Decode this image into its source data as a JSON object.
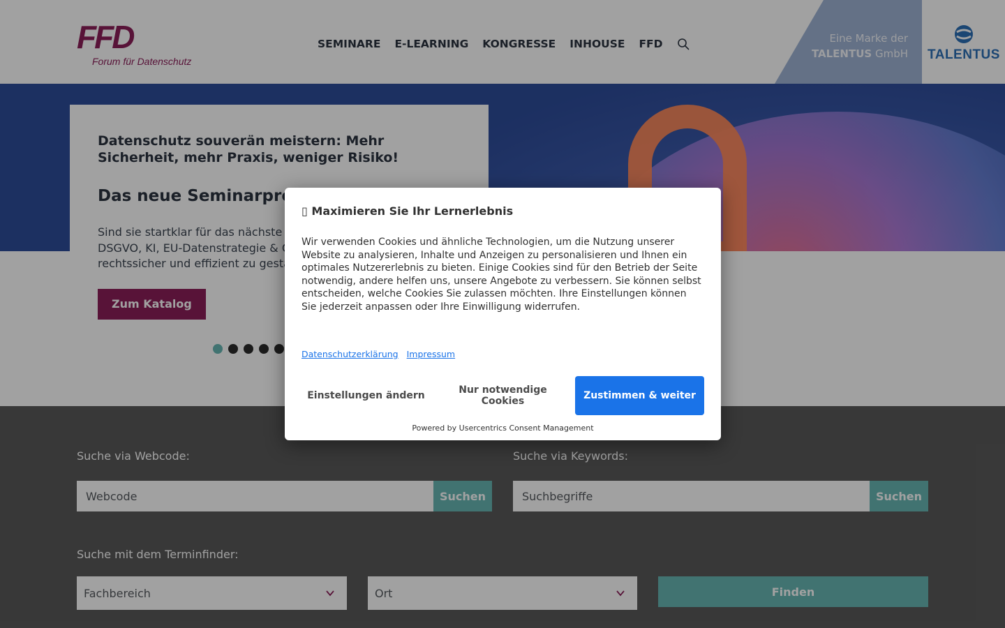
{
  "header": {
    "logo": {
      "mark": "FFD",
      "subtitle": "Forum für Datenschutz"
    },
    "nav": [
      {
        "label": "SEMINARE"
      },
      {
        "label": "E-LEARNING"
      },
      {
        "label": "KONGRESSE"
      },
      {
        "label": "INHOUSE"
      },
      {
        "label": "FFD"
      }
    ],
    "search_icon": "search-icon",
    "brand": {
      "line1": "Eine Marke der",
      "line2_bold": "TALENTUS",
      "line2_rest": " GmbH"
    },
    "talentus_logo_text": "TALENTUS"
  },
  "hero": {
    "lead": "Datenschutz souverän meistern: Mehr Sicherheit, mehr Praxis, weniger Risiko!",
    "title": "Das neue Seminarprogr",
    "body_lines": [
      "Sind sie startklar für das nächste Ja",
      "DSGVO, KI, EU-Datenstrategie & Co",
      "rechtssicher und effizient zu gestalt"
    ],
    "button": "Zum Katalog",
    "slide_count": 5,
    "active_slide": 1
  },
  "search": {
    "webcode_label": "Suche via Webcode:",
    "webcode_placeholder": "Webcode",
    "webcode_button": "Suchen",
    "keywords_label": "Suche via Keywords:",
    "keywords_placeholder": "Suchbegriffe",
    "keywords_button": "Suchen",
    "finder_label": "Suche mit dem Terminfinder:",
    "fachbereich": "Fachbereich",
    "ort": "Ort",
    "find_button": "Finden"
  },
  "consent": {
    "title_icon": "▯",
    "title": "Maximieren Sie Ihr Lernerlebnis",
    "text": "Wir verwenden Cookies und ähnliche Technologien, um die Nutzung unserer Website zu analysieren, Inhalte und Anzeigen zu personalisieren und Ihnen ein optimales Nutzererlebnis zu bieten. Einige Cookies sind für den Betrieb der Seite notwendig, andere helfen uns, unsere Angebote zu verbessern. Sie können selbst entscheiden, welche Cookies Sie zulassen möchten. Ihre Einstellungen können Sie jederzeit anpassen oder Ihre Einwilligung widerrufen.",
    "links": [
      "Datenschutzerklärung",
      "Impressum"
    ],
    "buttons": {
      "settings": "Einstellungen ändern",
      "necessary": "Nur notwendige Cookies",
      "accept": "Zustimmen & weiter"
    },
    "powered_by": "Powered by Usercentrics Consent Management"
  },
  "colors": {
    "brand_magenta": "#8c1f5a",
    "teal": "#67b7b4",
    "consent_blue": "#1a73e8",
    "search_bg": "#5a5a5a",
    "talentus_blue": "#2c6fb7"
  }
}
